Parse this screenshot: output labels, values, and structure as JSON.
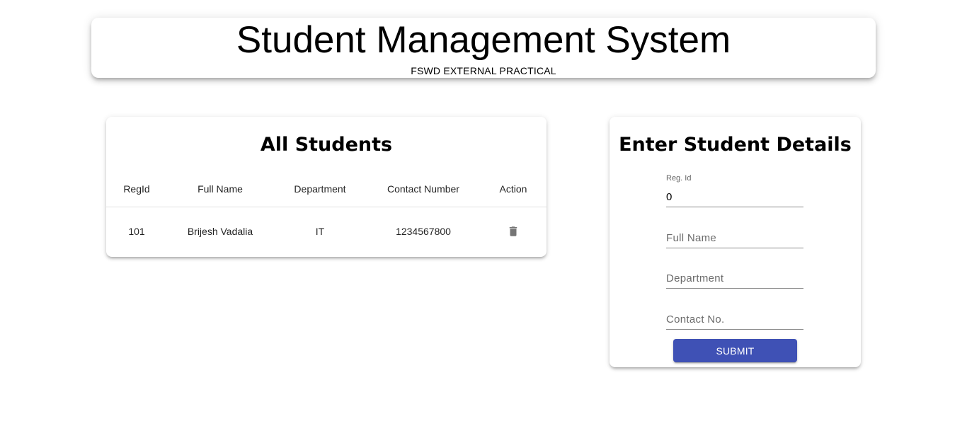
{
  "header": {
    "title": "Student Management System",
    "subtitle": "FSWD EXTERNAL PRACTICAL"
  },
  "students_panel": {
    "title": "All Students",
    "columns": [
      "RegId",
      "Full Name",
      "Department",
      "Contact Number",
      "Action"
    ],
    "rows": [
      {
        "regid": "101",
        "full_name": "Brijesh Vadalia",
        "department": "IT",
        "contact": "1234567800",
        "action_icon": "delete-icon"
      }
    ]
  },
  "form_panel": {
    "title": "Enter Student Details",
    "fields": {
      "regid": {
        "label": "Reg. Id",
        "value": "0"
      },
      "full_name": {
        "placeholder": "Full Name",
        "value": ""
      },
      "department": {
        "placeholder": "Department",
        "value": ""
      },
      "contact": {
        "placeholder": "Contact No.",
        "value": ""
      }
    },
    "submit_label": "Submit"
  },
  "colors": {
    "primary": "#3f51b5",
    "icon_gray": "#757575"
  }
}
